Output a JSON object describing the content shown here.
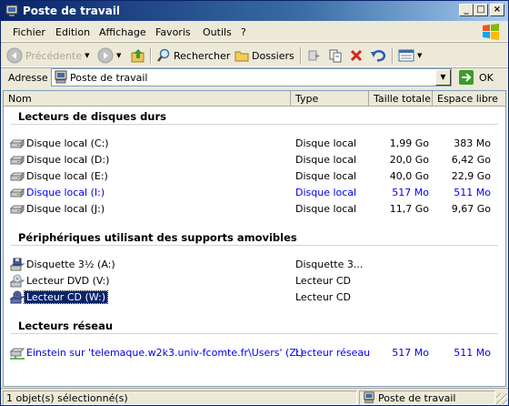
{
  "window": {
    "title": "Poste de travail"
  },
  "menu": [
    {
      "label": "Fichier",
      "name": "menu-fichier"
    },
    {
      "label": "Edition",
      "name": "menu-edition"
    },
    {
      "label": "Affichage",
      "name": "menu-affichage"
    },
    {
      "label": "Favoris",
      "name": "menu-favoris"
    },
    {
      "label": "Outils",
      "name": "menu-outils"
    },
    {
      "label": "?",
      "name": "menu-help"
    }
  ],
  "toolbar": {
    "back_label": "Précédente",
    "search_label": "Rechercher",
    "folders_label": "Dossiers"
  },
  "address": {
    "label": "Adresse",
    "value": "Poste de travail",
    "go_label": "OK"
  },
  "columns": {
    "name": "Nom",
    "type": "Type",
    "total": "Taille totale",
    "free": "Espace libre"
  },
  "groups": {
    "hard_disks": {
      "title": "Lecteurs de disques durs",
      "rows": [
        {
          "name": "Disque local (C:)",
          "type": "Disque local",
          "total": "1,99 Go",
          "free": "383 Mo",
          "blue": false
        },
        {
          "name": "Disque local (D:)",
          "type": "Disque local",
          "total": "20,0 Go",
          "free": "6,42 Go",
          "blue": false
        },
        {
          "name": "Disque local (E:)",
          "type": "Disque local",
          "total": "40,0 Go",
          "free": "22,9 Go",
          "blue": false
        },
        {
          "name": "Disque local (I:)",
          "type": "Disque local",
          "total": "517 Mo",
          "free": "511 Mo",
          "blue": true
        },
        {
          "name": "Disque local (J:)",
          "type": "Disque local",
          "total": "11,7 Go",
          "free": "9,67 Go",
          "blue": false
        }
      ]
    },
    "removable": {
      "title": "Périphériques utilisant des supports amovibles",
      "rows": [
        {
          "name": "Disquette 3½ (A:)",
          "type": "Disquette 3..."
        },
        {
          "name": "Lecteur DVD (V:)",
          "type": "Lecteur CD"
        },
        {
          "name": "Lecteur CD (W:)",
          "type": "Lecteur CD",
          "selected": true
        }
      ]
    },
    "network": {
      "title": "Lecteurs réseau",
      "rows": [
        {
          "name": "Einstein sur 'telemaque.w2k3.univ-fcomte.fr\\Users' (Z:)",
          "type": "Lecteur réseau",
          "total": "517 Mo",
          "free": "511 Mo"
        }
      ]
    }
  },
  "status": {
    "selection": "1 objet(s) sélectionné(s)",
    "location": "Poste de travail"
  }
}
